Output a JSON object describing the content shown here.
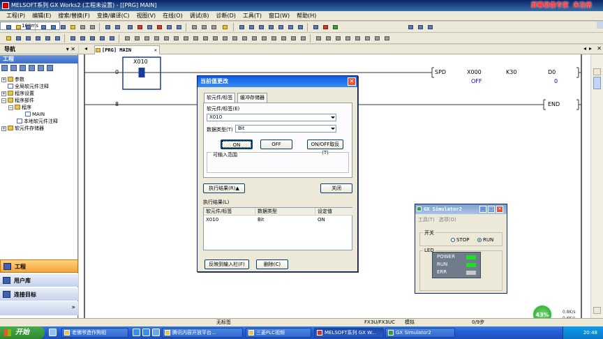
{
  "window": {
    "title": "MELSOFT系列 GX Works2 (工程未设置) - [[PRG] MAIN]",
    "watermark_a": "屏幕录像专家",
    "watermark_b": "未注册"
  },
  "menu": [
    "工程(P)",
    "编辑(E)",
    "搜索/替换(F)",
    "变换/编译(C)",
    "视图(V)",
    "在线(O)",
    "调试(B)",
    "诊断(D)",
    "工具(T)",
    "窗口(W)",
    "帮助(H)"
  ],
  "toolbar": {
    "scan_time": "100ms"
  },
  "nav": {
    "header": "导航",
    "project_title": "工程",
    "tree": {
      "params": "参数",
      "global_comment": "全局软元件注释",
      "program_settings": "程序设置",
      "program_parts": "程序部件",
      "program": "程序",
      "main": "MAIN",
      "local_comment": "本地软元件注释",
      "device_memory": "软元件存储器"
    },
    "bottom": {
      "project": "工程",
      "user_lib": "用户库",
      "connection": "连接目标"
    }
  },
  "editor": {
    "tab_label": "[PRG] MAIN",
    "rungs": [
      {
        "step": "0",
        "contact": "X010",
        "instr": "SPD",
        "op1": "X000",
        "op1_val": "OFF",
        "op2": "K30",
        "op3": "D0",
        "op3_val": "0"
      },
      {
        "step": "8",
        "instr": "END"
      }
    ]
  },
  "dialog": {
    "title": "当前值更改",
    "tabs": [
      "软元件/标签",
      "缓冲存储器"
    ],
    "device_label": "软元件/标签(E)",
    "device_value": "X010",
    "datatype_label": "数据类型(T)",
    "datatype_value": "Bit",
    "btn_on": "ON",
    "btn_off": "OFF",
    "btn_toggle": "ON/OFF取反(T)",
    "range_label": "可输入范围",
    "btn_exec_result": "执行结果(R)▲",
    "btn_close": "关闭",
    "result_label": "执行结果(L)",
    "table": {
      "headers": [
        "软元件/标签",
        "数据类型",
        "设定值"
      ],
      "rows": [
        [
          "X010",
          "Bit",
          "ON"
        ]
      ]
    },
    "btn_reflect": "反映到输入栏(F)",
    "btn_delete": "删除(C)"
  },
  "simulator": {
    "title": "GX Simulator2",
    "menu": [
      "工具(T)",
      "选项(O)"
    ],
    "switch_label": "开关",
    "stop": "STOP",
    "run": "RUN",
    "led_label": "LED",
    "leds": [
      {
        "name": "POWER",
        "color": "#22dd22"
      },
      {
        "name": "RUN",
        "color": "#22dd22"
      },
      {
        "name": "ERR",
        "color": "#c8c8c8"
      }
    ]
  },
  "status": {
    "label": "无标签",
    "cpu": "FX3U/FX3UC",
    "mode": "模拟",
    "steps": "0/9步"
  },
  "netwidget": {
    "percent": "43%",
    "up": "0.8K/s",
    "down": "0.6K/s"
  },
  "taskbar": {
    "start": "开始",
    "tasks": [
      "老佛爷造作狗相",
      "腾讯内容开放平台...",
      "三菱PLC视频",
      "MELSOFT系列 GX W...",
      "GX Simulator2"
    ],
    "clock": "20:48"
  }
}
